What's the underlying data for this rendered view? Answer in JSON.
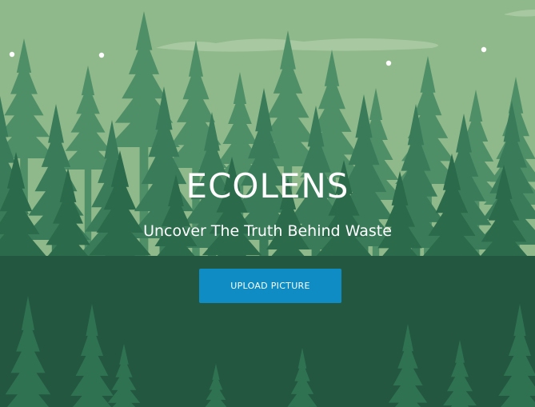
{
  "hero": {
    "title": "ECOLENS",
    "subtitle": "Uncover The Truth Behind Waste",
    "upload_button_label": "UPLOAD PICTURE"
  },
  "colors": {
    "sky": "#8fb98a",
    "cloud": "#b0ceaa",
    "star": "#ffffff",
    "tree_far": "#4f8f68",
    "tree_mid": "#3a7c59",
    "tree_near": "#2b6a4a",
    "ground": "#235740",
    "tree_fore": "#2f7252",
    "button_bg": "#0f8cc3",
    "text": "#ffffff"
  },
  "background_icon": "pine-forest-illustration"
}
